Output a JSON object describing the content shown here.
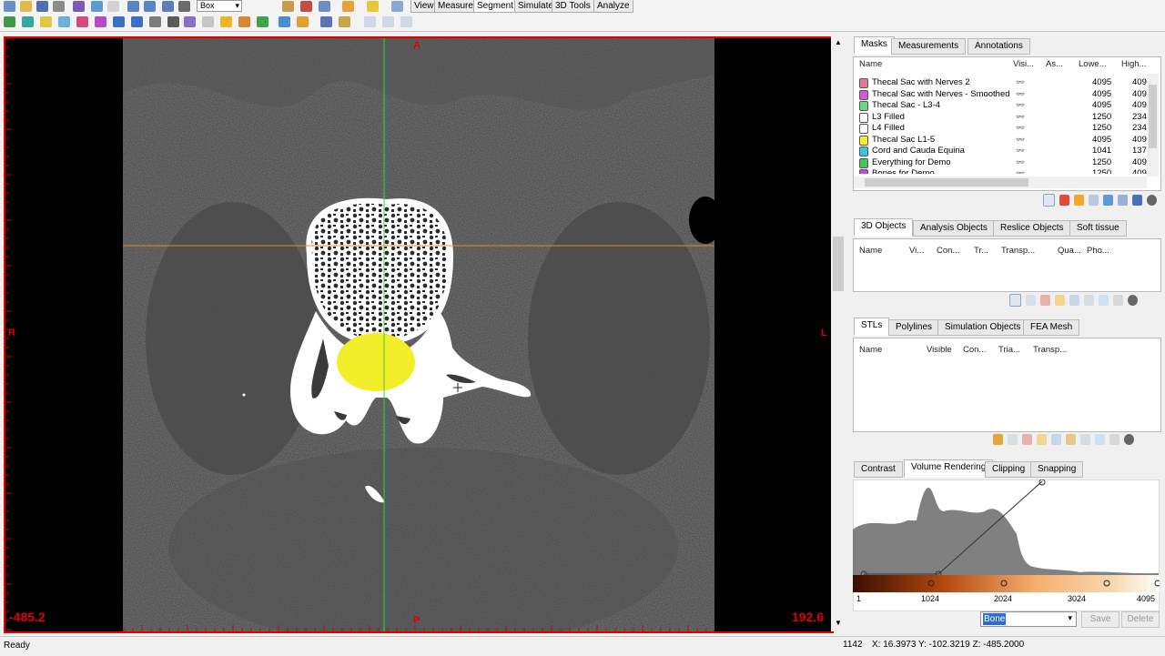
{
  "toolbar": {
    "shape_dropdown": "Box",
    "menu_tabs": [
      {
        "label": "View",
        "active": false
      },
      {
        "label": "Measure",
        "active": false
      },
      {
        "label": "Segment",
        "active": true
      },
      {
        "label": "Simulate",
        "active": false
      },
      {
        "label": "3D Tools",
        "active": false
      },
      {
        "label": "Analyze",
        "active": false
      }
    ]
  },
  "viewport": {
    "top_label": "A",
    "bottom_label": "P",
    "left_label": "R",
    "right_label": "L",
    "left_value": "-485.2",
    "right_value": "192.6",
    "accent": "#e00000",
    "mask_color": "#f2ee2a"
  },
  "masks_panel": {
    "tabs": [
      "Masks",
      "Measurements",
      "Annotations"
    ],
    "active_tab": "Masks",
    "columns": [
      "Name",
      "Visi...",
      "As...",
      "Lowe...",
      "High..."
    ],
    "rows": [
      {
        "name": "Thecal Sac with Nerves 2",
        "color": "#e07a9c",
        "visible": false,
        "low": "4095",
        "high": "409"
      },
      {
        "name": "Thecal Sac with Nerves - Smoothed",
        "color": "#d15bd2",
        "visible": false,
        "low": "4095",
        "high": "409"
      },
      {
        "name": "Thecal Sac - L3-4",
        "color": "#69d882",
        "visible": false,
        "low": "4095",
        "high": "409"
      },
      {
        "name": "L3 Filled",
        "color": "#ffffff",
        "visible": true,
        "low": "1250",
        "high": "234"
      },
      {
        "name": "L4 Filled",
        "color": "#ffffff",
        "visible": true,
        "low": "1250",
        "high": "234"
      },
      {
        "name": "Thecal Sac L1-5",
        "color": "#f3ef2a",
        "visible": true,
        "low": "4095",
        "high": "409"
      },
      {
        "name": "Cord and Cauda Equina",
        "color": "#35c8d8",
        "visible": false,
        "low": "1041",
        "high": "137"
      },
      {
        "name": "Everything for Demo",
        "color": "#49c25a",
        "visible": false,
        "low": "1250",
        "high": "409"
      },
      {
        "name": "Bones for Demo",
        "color": "#c84ad2",
        "visible": false,
        "low": "1250",
        "high": "409"
      }
    ]
  },
  "objects_panel": {
    "tabs": [
      "3D Objects",
      "Analysis Objects",
      "Reslice Objects",
      "Soft tissue"
    ],
    "active_tab": "3D Objects",
    "columns": [
      "Name",
      "Vi...",
      "Con...",
      "Tr...",
      "Transp...",
      "Qua...",
      "Pho..."
    ]
  },
  "stl_panel": {
    "tabs": [
      "STLs",
      "Polylines",
      "Simulation Objects",
      "FEA Mesh"
    ],
    "active_tab": "STLs",
    "columns": [
      "Name",
      "Visible",
      "Con...",
      "Tria...",
      "Transp..."
    ]
  },
  "render_panel": {
    "tabs": [
      "Contrast",
      "Volume Rendering",
      "Clipping",
      "Snapping"
    ],
    "active_tab": "Volume Rendering",
    "axis_ticks": [
      "1",
      "1024",
      "2024",
      "3024",
      "4095"
    ],
    "preset_value": "Bone",
    "save_label": "Save",
    "delete_label": "Delete"
  },
  "status": {
    "text": "Ready",
    "slice": "1142",
    "coords": "X: 16.3973  Y: -102.3219  Z: -485.2000"
  }
}
